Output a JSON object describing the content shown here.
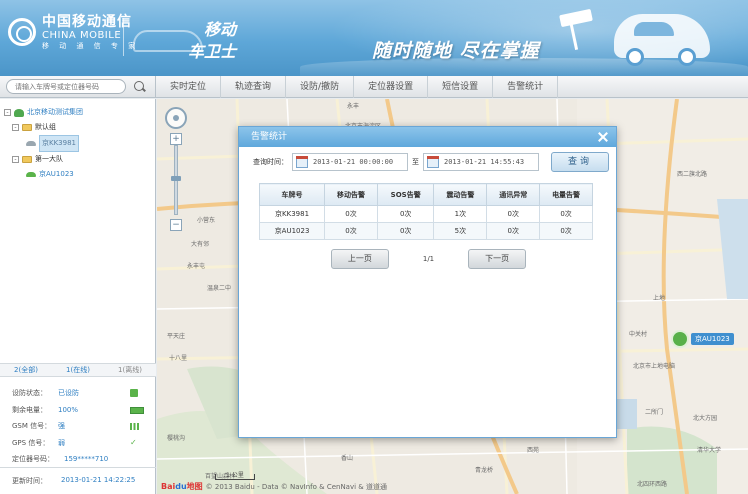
{
  "header": {
    "brand_cn": "中国移动通信",
    "brand_en": "CHINA MOBILE",
    "brand_sub": "移 动 通 信 专 家",
    "product_line1": "移动",
    "product_line2": "车卫士",
    "slogan": "随时随地  尽在掌握"
  },
  "nav": {
    "search_placeholder": "请输入车牌号或定位器号码",
    "tabs": [
      "实时定位",
      "轨迹查询",
      "设防/撤防",
      "定位器设置",
      "短信设置",
      "告警统计"
    ]
  },
  "sidebar": {
    "tree": {
      "root": "北京移动测试集团",
      "groups": [
        {
          "name": "默认组",
          "vehicles": [
            "京KK3981"
          ]
        },
        {
          "name": "第一大队",
          "vehicles": [
            "京AU1023"
          ]
        }
      ]
    },
    "stats": {
      "all": "2(全部)",
      "online": "1(在线)",
      "offline": "1(离线)"
    },
    "info": [
      {
        "label": "设防状态：",
        "value": "已设防",
        "icon": "lock-icon"
      },
      {
        "label": "剩余电量：",
        "value": "100%",
        "icon": "battery-icon"
      },
      {
        "label": "GSM 信号：",
        "value": "强",
        "icon": "signal-icon"
      },
      {
        "label": "GPS 信号：",
        "value": "弱",
        "icon": "check-icon"
      },
      {
        "label": "定位器号码：",
        "value": "159*****710",
        "icon": ""
      }
    ],
    "update_label": "更新时间：",
    "update_value": "2013-01-21 14:22:25"
  },
  "map": {
    "labels": [
      "永丰",
      "北京市海淀区",
      "上地",
      "西二旗北路",
      "百望山森林",
      "小营东",
      "大有邻",
      "永丰屯",
      "温泉二中",
      "平天庄",
      "十八里",
      "中关村",
      "二所门",
      "北京市上地电脑",
      "清华大学",
      "北大方园",
      "北四环西路",
      "青龙桥",
      "西苑",
      "香山",
      "樱桃沟"
    ],
    "marker_label": "京AU1023",
    "scale": "1 公里",
    "copyright": "© 2013 Baidu - Data © NavInfo & CenNavi & 道道通",
    "baidu": "Bai",
    "baidu2": "du",
    "baidu3": "地图"
  },
  "dialog": {
    "title": "告警统计",
    "query_label": "查询时间：",
    "from": "2013-01-21 00:00:00",
    "to_label": "至",
    "to": "2013-01-21 14:55:43",
    "query_button": "查询",
    "columns": [
      "车牌号",
      "移动告警",
      "SOS告警",
      "震动告警",
      "通讯异常",
      "电量告警"
    ],
    "rows": [
      [
        "京KK3981",
        "0次",
        "0次",
        "1次",
        "0次",
        "0次"
      ],
      [
        "京AU1023",
        "0次",
        "0次",
        "5次",
        "0次",
        "0次"
      ]
    ],
    "prev": "上一页",
    "next": "下一页",
    "page": "1/1"
  }
}
